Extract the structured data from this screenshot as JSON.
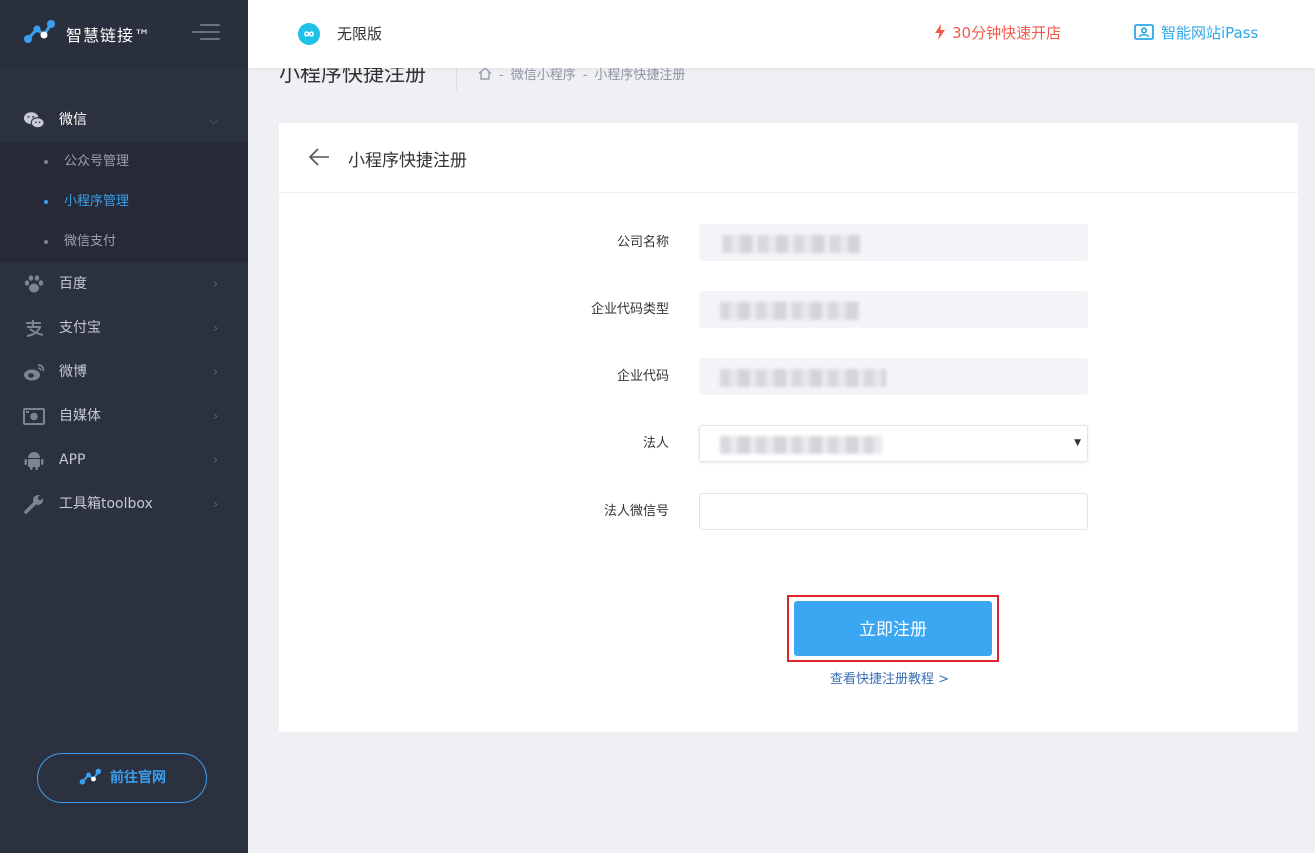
{
  "brand": {
    "title": "智慧链接™"
  },
  "sidebar": {
    "groups": [
      {
        "label": "微信",
        "icon": "wechat-icon",
        "open": true,
        "items": [
          {
            "label": "公众号管理",
            "active": false
          },
          {
            "label": "小程序管理",
            "active": true
          },
          {
            "label": "微信支付",
            "active": false
          }
        ]
      },
      {
        "label": "百度",
        "icon": "baidu-paw-icon"
      },
      {
        "label": "支付宝",
        "icon": "alipay-icon"
      },
      {
        "label": "微博",
        "icon": "weibo-icon"
      },
      {
        "label": "自媒体",
        "icon": "media-icon"
      },
      {
        "label": "APP",
        "icon": "android-icon"
      },
      {
        "label": "工具箱toolbox",
        "icon": "wrench-icon"
      }
    ],
    "goto_site": "前往官网"
  },
  "topbar": {
    "edition": "无限版",
    "quick_open": "30分钟快速开店",
    "ipass": "智能网站iPass"
  },
  "page": {
    "title": "小程序快捷注册",
    "breadcrumb": [
      "微信小程序",
      "小程序快捷注册"
    ]
  },
  "card": {
    "title": "小程序快捷注册",
    "fields": [
      {
        "label": "公司名称"
      },
      {
        "label": "企业代码类型"
      },
      {
        "label": "企业代码"
      },
      {
        "label": "法人"
      },
      {
        "label": "法人微信号"
      }
    ],
    "register_label": "立即注册",
    "tutorial_link": "查看快捷注册教程 >"
  },
  "colors": {
    "accent": "#3ba6f2",
    "sidebar_bg": "#2c3140",
    "highlight_border": "#e0242b",
    "quick_open": "#f15a4a"
  }
}
